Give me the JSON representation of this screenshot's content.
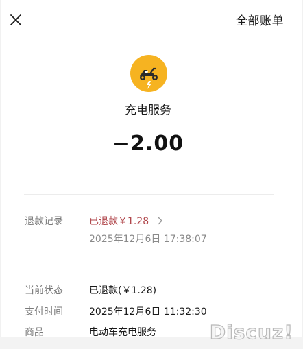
{
  "header": {
    "all_bills_label": "全部账单"
  },
  "merchant": {
    "name": "充电服务",
    "logo_icon": "e-bike-charging-icon",
    "logo_color": "#F6B321"
  },
  "amount": "−2.00",
  "refund": {
    "label": "退款记录",
    "status_text": "已退款￥1.28",
    "time": "2025年12月6日 17:38:07",
    "accent_color": "#B0464B"
  },
  "details": [
    {
      "label": "当前状态",
      "value": "已退款(￥1.28)"
    },
    {
      "label": "支付时间",
      "value": "2025年12月6日 11:32:30"
    },
    {
      "label": "商品",
      "value": "电动车充电服务"
    }
  ],
  "watermark": "Discuz!"
}
